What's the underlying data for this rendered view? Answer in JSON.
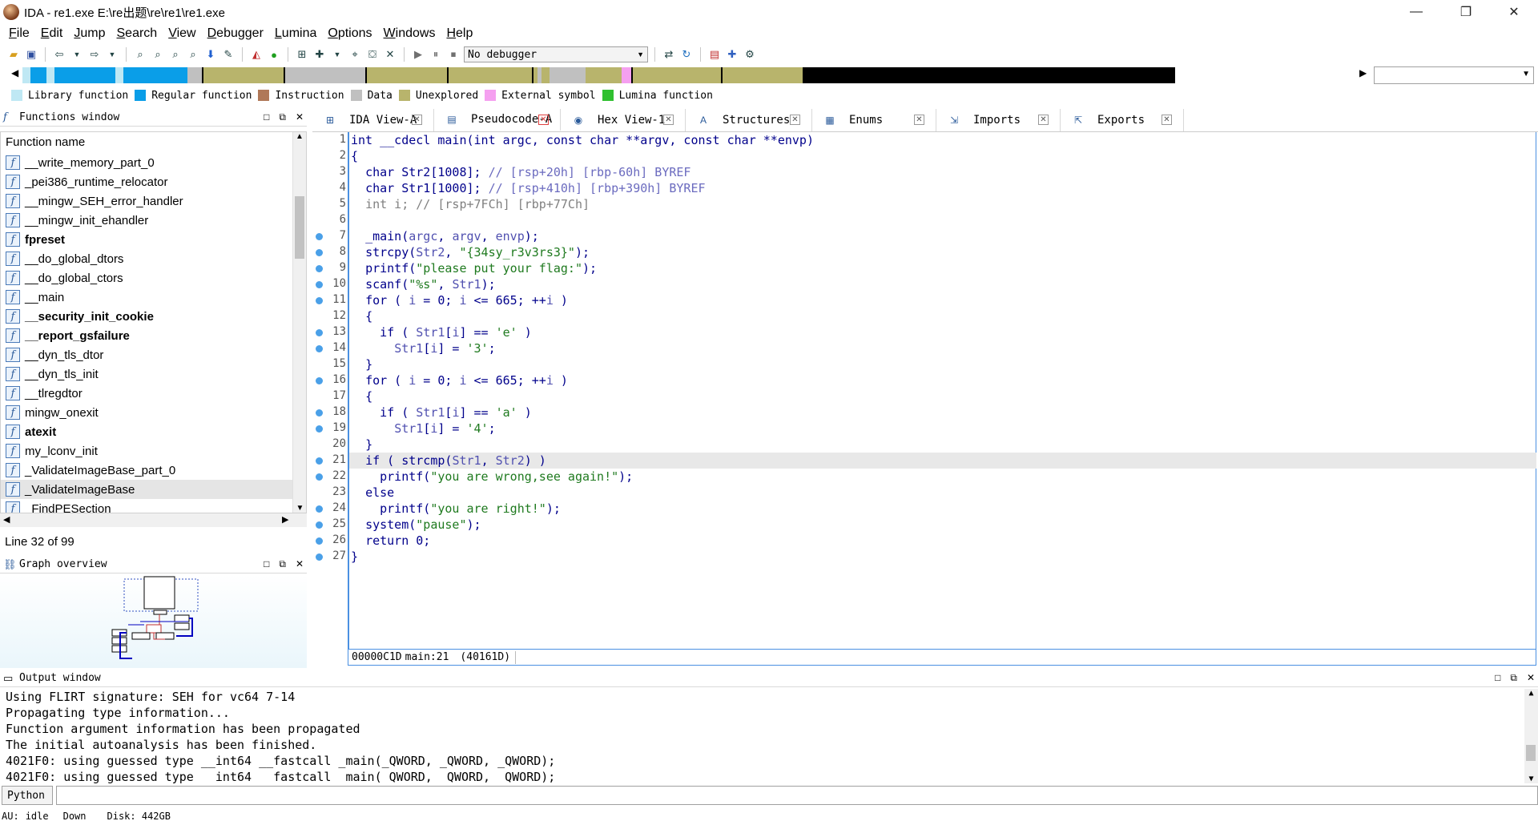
{
  "window": {
    "title": "IDA - re1.exe E:\\re出题\\re\\re1\\re1.exe",
    "minimize": "—",
    "maximize": "❐",
    "close": "✕"
  },
  "menu": [
    {
      "label": "File",
      "u": "F",
      "rest": "ile"
    },
    {
      "label": "Edit",
      "u": "E",
      "rest": "dit"
    },
    {
      "label": "Jump",
      "u": "J",
      "rest": "ump"
    },
    {
      "label": "Search",
      "u": "S",
      "rest": "earch"
    },
    {
      "label": "View",
      "u": "V",
      "rest": "iew"
    },
    {
      "label": "Debugger",
      "u": "D",
      "rest": "ebugger"
    },
    {
      "label": "Lumina",
      "u": "L",
      "rest": "umina"
    },
    {
      "label": "Options",
      "u": "O",
      "rest": "ptions"
    },
    {
      "label": "Windows",
      "u": "W",
      "rest": "indows"
    },
    {
      "label": "Help",
      "u": "H",
      "rest": "elp"
    }
  ],
  "toolbar": {
    "debugger_value": "No debugger"
  },
  "legend": [
    {
      "label": "Library function",
      "color": "#bfe8f4"
    },
    {
      "label": "Regular function",
      "color": "#0a9ee8"
    },
    {
      "label": "Instruction",
      "color": "#b07858"
    },
    {
      "label": "Data",
      "color": "#c0c0c0"
    },
    {
      "label": "Unexplored",
      "color": "#b8b46c"
    },
    {
      "label": "External symbol",
      "color": "#f5a0f0"
    },
    {
      "label": "Lumina function",
      "color": "#30c030"
    }
  ],
  "functions_window": {
    "title": "Functions window",
    "column": "Function name",
    "items": [
      {
        "name": "__write_memory_part_0",
        "bold": false
      },
      {
        "name": "_pei386_runtime_relocator",
        "bold": false
      },
      {
        "name": "__mingw_SEH_error_handler",
        "bold": false
      },
      {
        "name": "__mingw_init_ehandler",
        "bold": false
      },
      {
        "name": "fpreset",
        "bold": true
      },
      {
        "name": "__do_global_dtors",
        "bold": false
      },
      {
        "name": "__do_global_ctors",
        "bold": false
      },
      {
        "name": "__main",
        "bold": false
      },
      {
        "name": "__security_init_cookie",
        "bold": true
      },
      {
        "name": "__report_gsfailure",
        "bold": true
      },
      {
        "name": "__dyn_tls_dtor",
        "bold": false
      },
      {
        "name": "__dyn_tls_init",
        "bold": false
      },
      {
        "name": "__tlregdtor",
        "bold": false
      },
      {
        "name": "mingw_onexit",
        "bold": false
      },
      {
        "name": "atexit",
        "bold": true
      },
      {
        "name": "my_lconv_init",
        "bold": false
      },
      {
        "name": "_ValidateImageBase_part_0",
        "bold": false
      },
      {
        "name": "_ValidateImageBase",
        "bold": false
      },
      {
        "name": "_FindPESection",
        "bold": false
      }
    ],
    "line_status": "Line 32 of 99"
  },
  "graph_overview": {
    "title": "Graph overview"
  },
  "tabs": [
    {
      "label": "IDA View-A",
      "icon": "⊞"
    },
    {
      "label": "Pseudocode-A",
      "icon": "▤"
    },
    {
      "label": "Hex View-1",
      "icon": "◉"
    },
    {
      "label": "Structures",
      "icon": "A"
    },
    {
      "label": "Enums",
      "icon": "▦"
    },
    {
      "label": "Imports",
      "icon": "⇲"
    },
    {
      "label": "Exports",
      "icon": "⇱"
    }
  ],
  "code": {
    "status_offset": "00000C1D",
    "status_location": "main:21",
    "status_address": "(40161D)"
  },
  "output_window": {
    "title": "Output window",
    "lines": [
      "Using FLIRT signature: SEH for vc64 7-14",
      "Propagating type information...",
      "Function argument information has been propagated",
      "The initial autoanalysis has been finished.",
      "4021F0: using guessed type __int64 __fastcall _main(_QWORD, _QWORD, _QWORD);",
      "4021F0: using guessed type __int64 __fastcall _main(_QWORD, _QWORD, _QWORD);"
    ]
  },
  "cli": {
    "language": "Python"
  },
  "statusbar": {
    "au_label": "AU:",
    "au_state": "idle",
    "direction": "Down",
    "disk": "Disk: 442GB"
  }
}
